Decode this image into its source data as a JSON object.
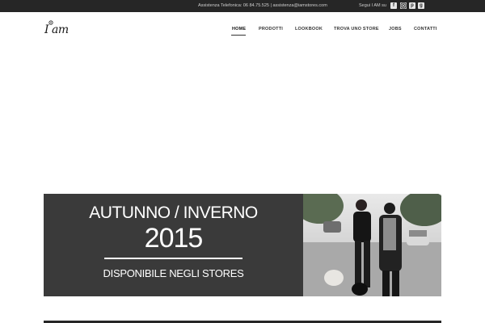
{
  "topbar": {
    "contact_text": "Assistenza Telefonica: 06 84.75.525 | assistenza@iamstores.com",
    "follow_text": "Segui I AM su",
    "social_icons": [
      "facebook-icon",
      "instagram-icon",
      "pinterest-icon",
      "google-plus-icon"
    ]
  },
  "logo": {
    "text": "I am"
  },
  "nav": {
    "items": [
      {
        "label": "HOME",
        "active": true
      },
      {
        "label": "PRODOTTI"
      },
      {
        "label": "LOOKBOOK"
      },
      {
        "label": "TROVA UNO STORE"
      },
      {
        "label": "JOBS"
      },
      {
        "label": "CONTATTI"
      }
    ]
  },
  "banner": {
    "season": "AUTUNNO / INVERNO",
    "year": "2015",
    "tagline": "DISPONIBILE NEGLI STORES"
  },
  "colors": {
    "topbar_bg": "#262626",
    "banner_bg": "#3a3a3a",
    "text_dark": "#333333"
  }
}
